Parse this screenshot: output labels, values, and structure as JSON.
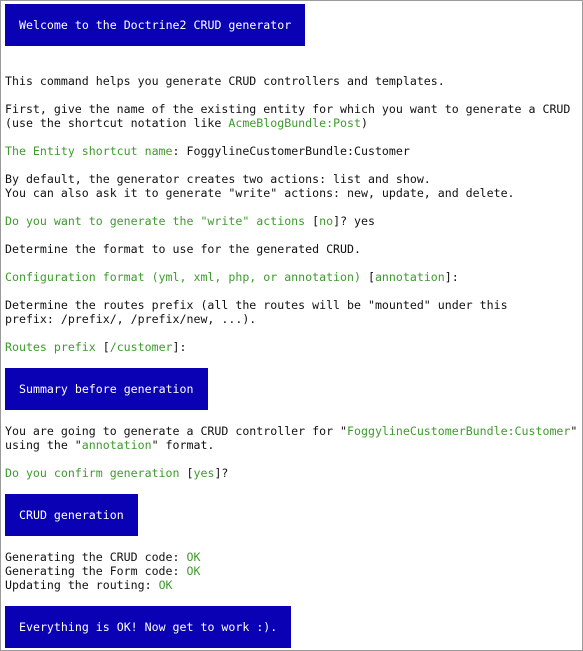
{
  "colors": {
    "block_bg": "#0a00b4",
    "block_text": "#ffffff",
    "highlight": "#3f9a2f",
    "text": "#111111",
    "background": "#ffffff"
  },
  "welcome": "Welcome to the Doctrine2 CRUD generator",
  "intro": "This command helps you generate CRUD controllers and templates.",
  "entity_hint_1": "First, give the name of the existing entity for which you want to generate a CRUD",
  "entity_hint_2_prefix": "(use the shortcut notation like ",
  "entity_hint_2_example": "AcmeBlogBundle:Post",
  "entity_hint_2_suffix": ")",
  "entity_prompt": "The Entity shortcut name",
  "entity_answer": ": FoggylineCustomerBundle:Customer",
  "actions_1": "By default, the generator creates two actions: list and show.",
  "actions_2": "You can also ask it to generate \"write\" actions: new, update, and delete.",
  "write_prompt": "Do you want to generate the \"write\" actions",
  "write_default_open": " [",
  "write_default": "no",
  "write_default_close": "]? yes",
  "format_hint": "Determine the format to use for the generated CRUD.",
  "format_prompt": "Configuration format (yml, xml, php, or annotation)",
  "format_default_open": " [",
  "format_default": "annotation",
  "format_default_close": "]:",
  "routes_hint_1": "Determine the routes prefix (all the routes will be \"mounted\" under this",
  "routes_hint_2": "prefix: /prefix/, /prefix/new, ...).",
  "routes_prompt": "Routes prefix",
  "routes_default_open": " [",
  "routes_default": "/customer",
  "routes_default_close": "]:",
  "summary_title": "Summary before generation",
  "summary_1_prefix": "You are going to generate a CRUD controller for \"",
  "summary_1_entity": "FoggylineCustomerBundle:Customer",
  "summary_1_suffix": "\"",
  "summary_2_prefix": "using the \"",
  "summary_2_format": "annotation",
  "summary_2_suffix": "\" format.",
  "confirm_prompt": "Do you confirm generation",
  "confirm_default_open": " [",
  "confirm_default": "yes",
  "confirm_default_close": "]?",
  "generation_title": "CRUD generation",
  "gen_crud_label": "Generating the CRUD code: ",
  "gen_crud_status": "OK",
  "gen_form_label": "Generating the Form code: ",
  "gen_form_status": "OK",
  "gen_routing_label": "Updating the routing: ",
  "gen_routing_status": "OK",
  "done_message": "Everything is OK! Now get to work :)."
}
